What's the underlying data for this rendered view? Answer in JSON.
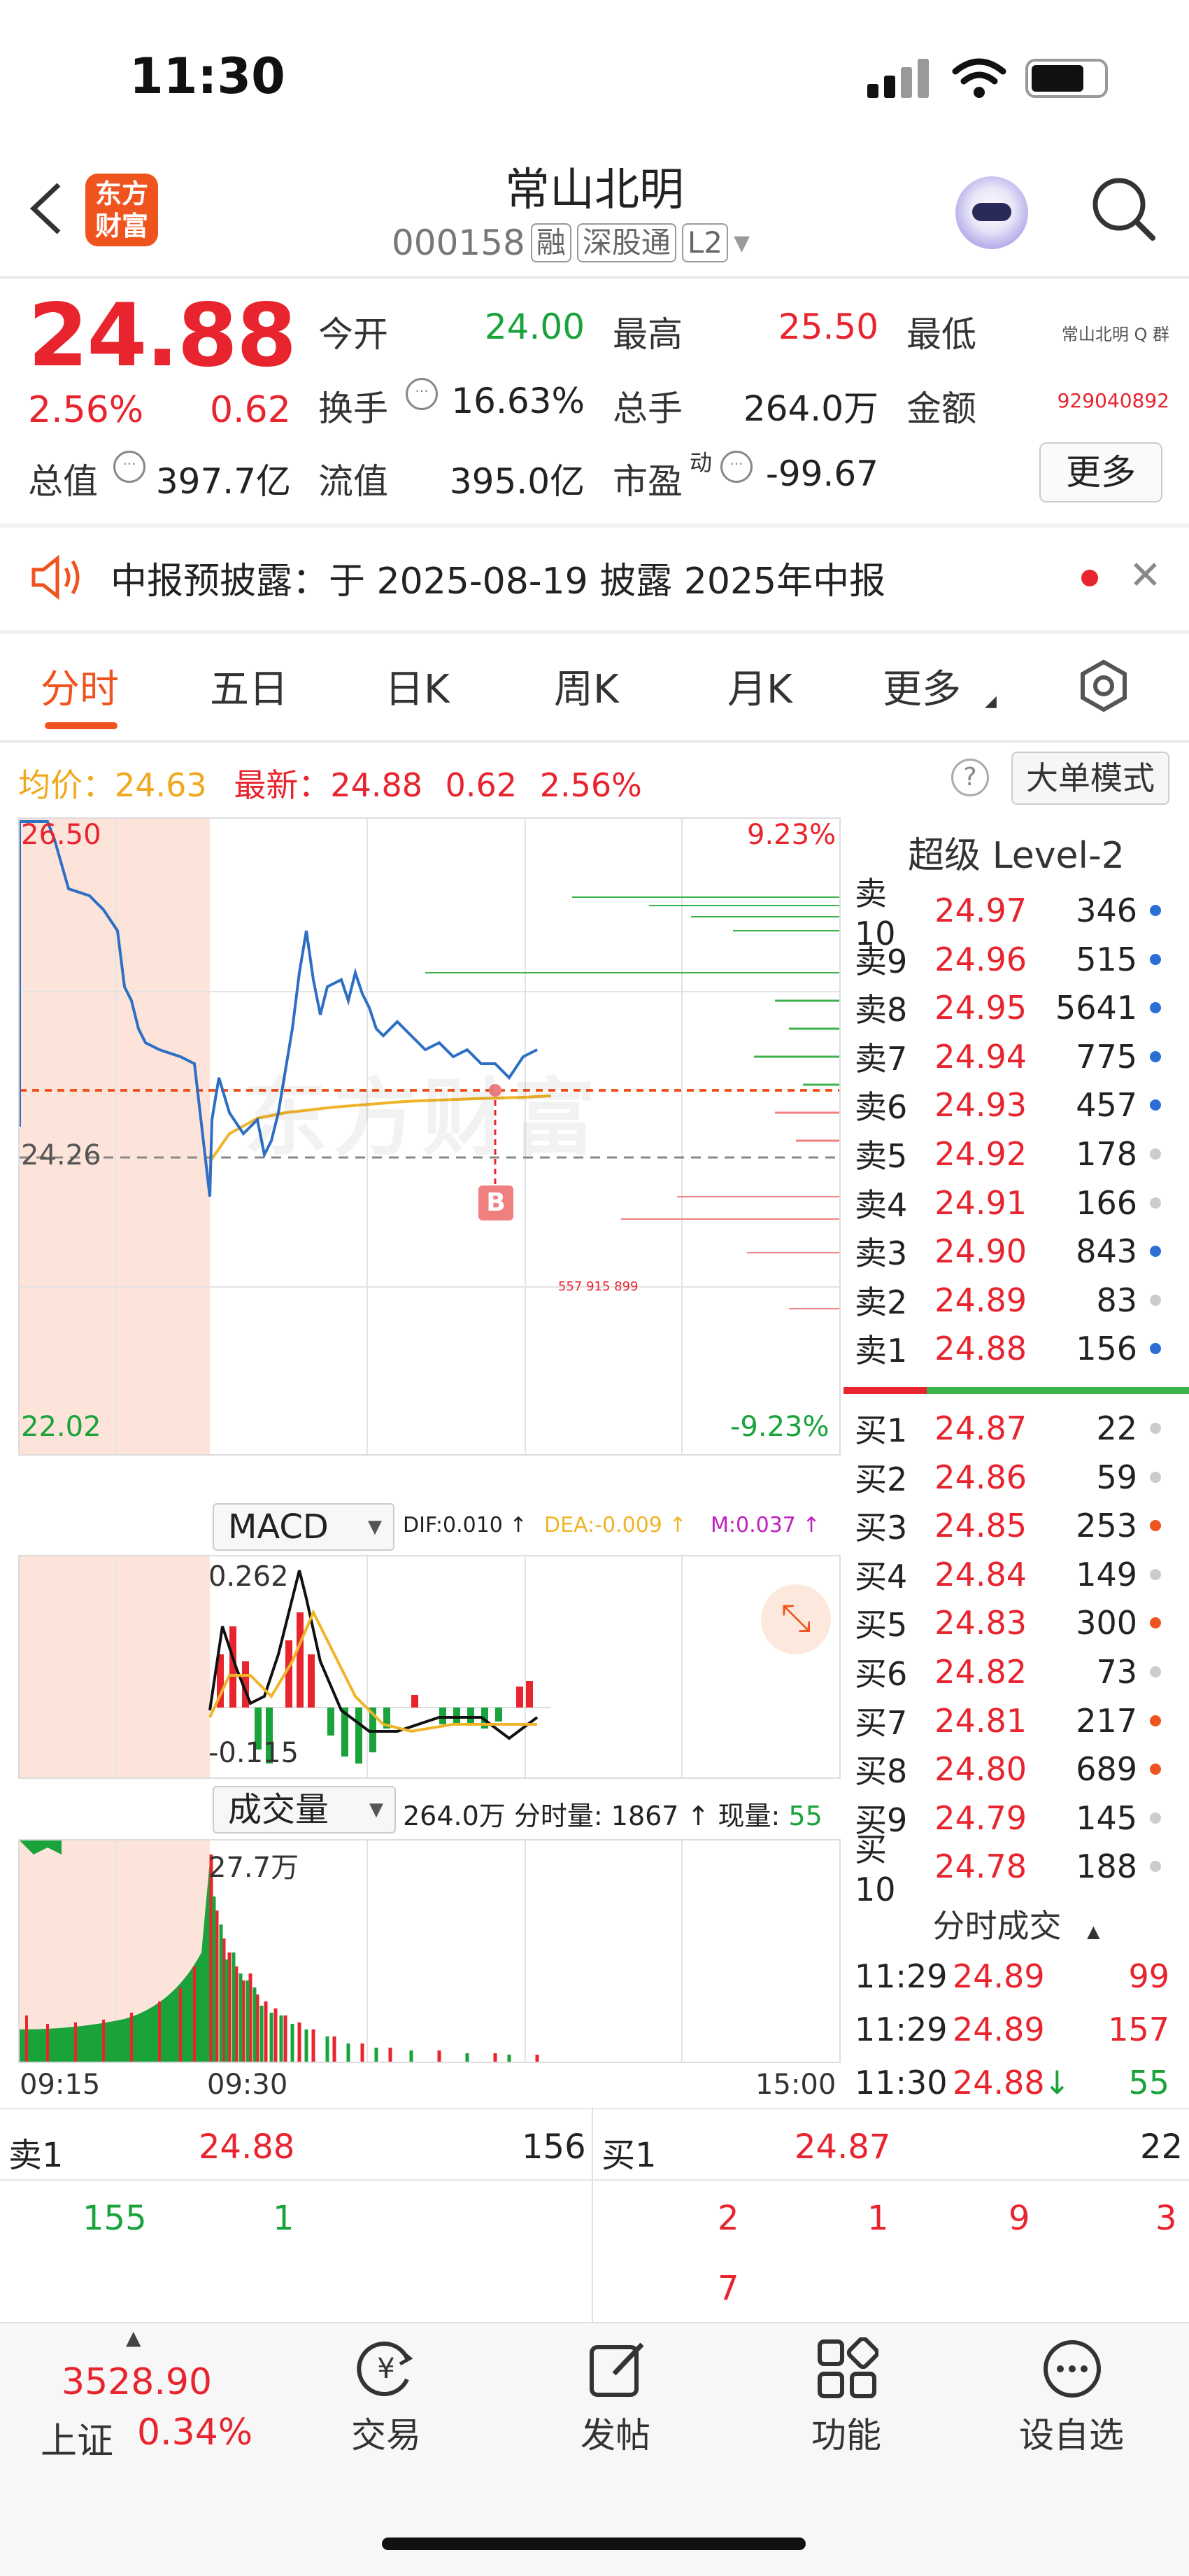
{
  "status_bar": {
    "time": "11:30"
  },
  "header": {
    "logo_text": "东方财富",
    "title": "常山北明",
    "code": "000158",
    "tags": [
      "融",
      "深股通",
      "L2"
    ]
  },
  "quote": {
    "price": "24.88",
    "change_pct": "2.56%",
    "change": "0.62",
    "open_label": "今开",
    "open": "24.00",
    "high_label": "最高",
    "high": "25.50",
    "low_label": "最低",
    "low_value": "常山北明 Q 群",
    "turnover_label": "换手",
    "turnover": "16.63%",
    "volume_label": "总手",
    "volume": "264.0万",
    "amount_label": "金额",
    "amount": "929040892",
    "mktcap_label": "总值",
    "mktcap": "397.7亿",
    "float_label": "流值",
    "float": "395.0亿",
    "pe_label": "市盈",
    "pe_sup": "动",
    "pe": "-99.67",
    "more": "更多"
  },
  "notice": {
    "text": "中报预披露：于 2025-08-19 披露 2025年中报"
  },
  "tabs": [
    "分时",
    "五日",
    "日K",
    "周K",
    "月K",
    "更多"
  ],
  "info_line": {
    "avg_label": "均价：",
    "avg": "24.63",
    "latest_label": "最新：",
    "latest": "24.88",
    "chg": "0.62",
    "pct": "2.56%",
    "mode_btn": "大单模式"
  },
  "chart": {
    "top_label": "26.50",
    "top_pct": "9.23%",
    "mid_label": "24.26",
    "bottom_label": "22.02",
    "bottom_pct": "-9.23%",
    "marker": "B",
    "tiny_text": "557 915 899",
    "watermark": "东方财富"
  },
  "macd": {
    "name": "MACD",
    "dif": "DIF:0.010 ↑",
    "dea": "DEA:-0.009 ↑",
    "m": "M:0.037 ↑",
    "max": "0.262",
    "min": "-0.115"
  },
  "volume_panel": {
    "name": "成交量",
    "total": "264.0万",
    "per_min": "分时量: 1867 ↑",
    "now_label": "现量:",
    "now": "55",
    "max": "27.7万",
    "t_start": "09:15",
    "t_open": "09:30",
    "t_end": "15:00"
  },
  "orderbook": {
    "title": "超级 Level-2",
    "asks": [
      {
        "l": "卖10",
        "p": "24.97",
        "v": "346",
        "c": "#2b6fd6"
      },
      {
        "l": "卖9",
        "p": "24.96",
        "v": "515",
        "c": "#2b6fd6"
      },
      {
        "l": "卖8",
        "p": "24.95",
        "v": "5641",
        "c": "#2b6fd6"
      },
      {
        "l": "卖7",
        "p": "24.94",
        "v": "775",
        "c": "#2b6fd6"
      },
      {
        "l": "卖6",
        "p": "24.93",
        "v": "457",
        "c": "#2b6fd6"
      },
      {
        "l": "卖5",
        "p": "24.92",
        "v": "178",
        "c": "#ccc"
      },
      {
        "l": "卖4",
        "p": "24.91",
        "v": "166",
        "c": "#ccc"
      },
      {
        "l": "卖3",
        "p": "24.90",
        "v": "843",
        "c": "#2b6fd6"
      },
      {
        "l": "卖2",
        "p": "24.89",
        "v": "83",
        "c": "#ccc"
      },
      {
        "l": "卖1",
        "p": "24.88",
        "v": "156",
        "c": "#2b6fd6"
      }
    ],
    "bids": [
      {
        "l": "买1",
        "p": "24.87",
        "v": "22",
        "c": "#ccc"
      },
      {
        "l": "买2",
        "p": "24.86",
        "v": "59",
        "c": "#ccc"
      },
      {
        "l": "买3",
        "p": "24.85",
        "v": "253",
        "c": "#f0541e"
      },
      {
        "l": "买4",
        "p": "24.84",
        "v": "149",
        "c": "#ccc"
      },
      {
        "l": "买5",
        "p": "24.83",
        "v": "300",
        "c": "#f0541e"
      },
      {
        "l": "买6",
        "p": "24.82",
        "v": "73",
        "c": "#ccc"
      },
      {
        "l": "买7",
        "p": "24.81",
        "v": "217",
        "c": "#f0541e"
      },
      {
        "l": "买8",
        "p": "24.80",
        "v": "689",
        "c": "#f0541e"
      },
      {
        "l": "买9",
        "p": "24.79",
        "v": "145",
        "c": "#ccc"
      },
      {
        "l": "买10",
        "p": "24.78",
        "v": "188",
        "c": "#ccc"
      }
    ],
    "ticks_title": "分时成交",
    "ticks": [
      {
        "t": "11:29",
        "p": "24.89",
        "v": "99",
        "arrow": ""
      },
      {
        "t": "11:29",
        "p": "24.89",
        "v": "157",
        "arrow": ""
      },
      {
        "t": "11:30",
        "p": "24.88",
        "v": "55",
        "arrow": "↓"
      }
    ]
  },
  "queue": {
    "sell_label": "卖1",
    "sell_price": "24.88",
    "sell_vol": "156",
    "buy_label": "买1",
    "buy_price": "24.87",
    "buy_vol": "22",
    "sell_orders": [
      "155",
      "1"
    ],
    "buy_orders": [
      "2",
      "1",
      "9",
      "3",
      "7"
    ]
  },
  "bottom_nav": {
    "index_value": "3528.90",
    "index_name": "上证",
    "index_pct": "0.34%",
    "items": [
      "交易",
      "发帖",
      "功能",
      "设自选"
    ]
  }
}
